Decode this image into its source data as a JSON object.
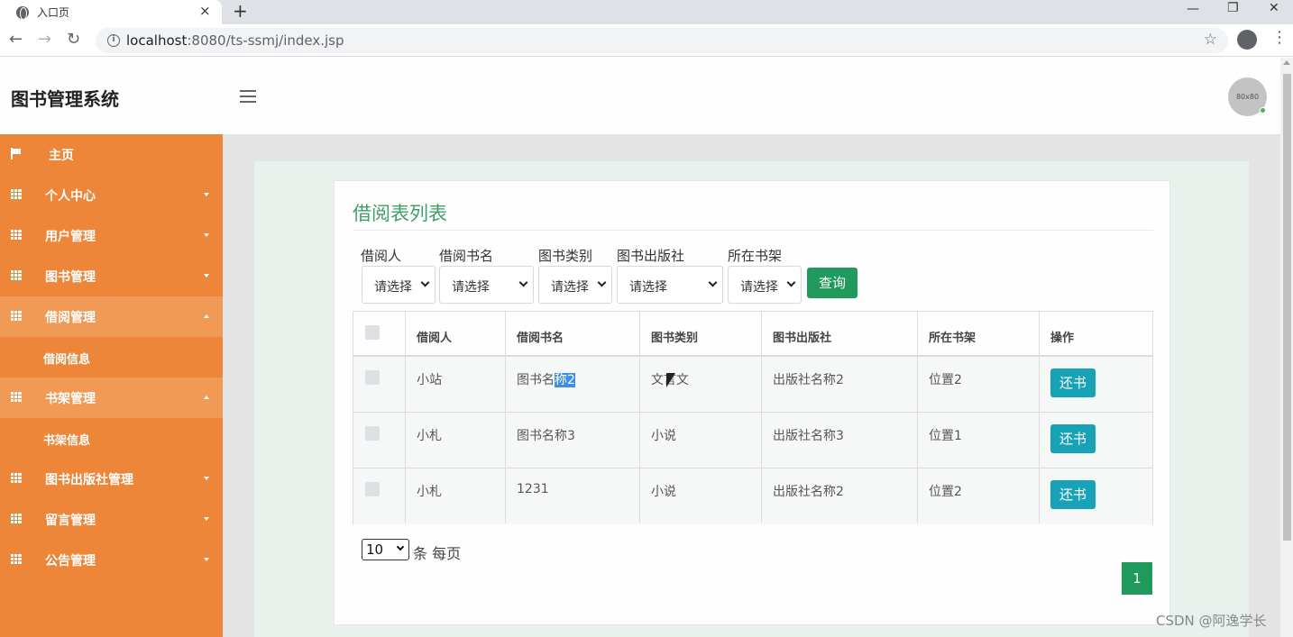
{
  "browser": {
    "tab_title": "入口页",
    "tab_close": "×",
    "new_tab": "+",
    "url_host": "localhost",
    "url_rest": ":8080/ts-ssmj/index.jsp",
    "info_icon": "i",
    "star_icon": "☆",
    "menu_icon": "⋮",
    "minimize": "—",
    "restore": "❐",
    "close": "✕",
    "back": "←",
    "forward": "→",
    "reload": "↻"
  },
  "header": {
    "brand": "图书管理系统",
    "avatar_text": "80x80"
  },
  "sidebar": {
    "items": [
      {
        "label": "主页"
      },
      {
        "label": "个人中心"
      },
      {
        "label": "用户管理"
      },
      {
        "label": "图书管理"
      },
      {
        "label": "借阅管理"
      },
      {
        "label": "借阅信息"
      },
      {
        "label": "书架管理"
      },
      {
        "label": "书架信息"
      },
      {
        "label": "图书出版社管理"
      },
      {
        "label": "留言管理"
      },
      {
        "label": "公告管理"
      }
    ]
  },
  "page": {
    "title": "借阅表列表",
    "filters": [
      {
        "label": "借阅人",
        "value": "请选择"
      },
      {
        "label": "借阅书名",
        "value": "请选择"
      },
      {
        "label": "图书类别",
        "value": "请选择"
      },
      {
        "label": "图书出版社",
        "value": "请选择"
      },
      {
        "label": "所在书架",
        "value": "请选择"
      }
    ],
    "query_button": "查询",
    "table": {
      "headers": [
        "借阅人",
        "借阅书名",
        "图书类别",
        "图书出版社",
        "所在书架",
        "操作"
      ],
      "rows": [
        {
          "borrower": "小站",
          "book_pre": "图书名",
          "book_sel": "称2",
          "category": "文言文",
          "publisher": "出版社名称2",
          "shelf": "位置2",
          "action": "还书"
        },
        {
          "borrower": "小札",
          "book": "图书名称3",
          "category": "小说",
          "publisher": "出版社名称3",
          "shelf": "位置1",
          "action": "还书"
        },
        {
          "borrower": "小札",
          "book": "1231",
          "category": "小说",
          "publisher": "出版社名称2",
          "shelf": "位置2",
          "action": "还书"
        }
      ]
    },
    "page_size": "10",
    "page_size_suffix": "条 每页",
    "current_page": "1"
  },
  "watermark": "CSDN @阿逸学长",
  "colors": {
    "sidebar": "#ed8638",
    "sidebar_active": "#f09a55",
    "accent_green": "#1f9a5c",
    "title_green": "#3f9e6a",
    "return_button": "#17a2b8"
  }
}
